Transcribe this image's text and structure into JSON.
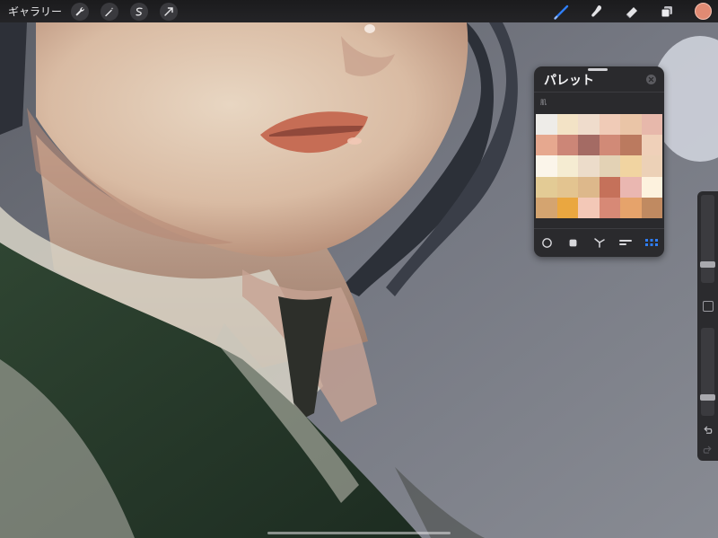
{
  "toolbar": {
    "gallery_label": "ギャラリー",
    "left_tools": [
      {
        "icon": "wrench-icon"
      },
      {
        "icon": "magic-wand-icon"
      },
      {
        "icon": "selection-icon"
      },
      {
        "icon": "transform-arrow-icon"
      }
    ],
    "right_tools": [
      {
        "icon": "brush-icon",
        "active": true,
        "color": "#2f7ef5"
      },
      {
        "icon": "smudge-icon",
        "active": false
      },
      {
        "icon": "eraser-icon",
        "active": false
      },
      {
        "icon": "layers-icon",
        "active": false
      }
    ],
    "current_color": "#e08a73"
  },
  "palette": {
    "title": "パレット",
    "palette_name": "肌",
    "swatches": [
      "#eeece8",
      "#f3e3c6",
      "#efdccc",
      "#f0cbb7",
      "#eac5a7",
      "#e7b8ab",
      "#e6a88f",
      "#cc8677",
      "#a46b64",
      "#d18a77",
      "#bb7a5f",
      "#efd0b9",
      "#fbf5ea",
      "#f5ecd2",
      "#ecdcca",
      "#e3d2b5",
      "#f1d4a1",
      "#ecd1b7",
      "#e3cb95",
      "#e3c490",
      "#ddb88b",
      "#c5715a",
      "#eab7b1",
      "#fdf2de",
      "#d4a470",
      "#eaa740",
      "#f3c8b7",
      "#d78976",
      "#e6a36b",
      "#c08a61"
    ],
    "modes": [
      {
        "icon": "disc-mode-icon",
        "active": false
      },
      {
        "icon": "classic-mode-icon",
        "active": false
      },
      {
        "icon": "harmony-mode-icon",
        "active": false
      },
      {
        "icon": "value-mode-icon",
        "active": false
      },
      {
        "icon": "palette-grid-icon",
        "active": true
      }
    ]
  },
  "sidebar": {
    "size_value": 0.19,
    "opacity_value": 0.19
  }
}
